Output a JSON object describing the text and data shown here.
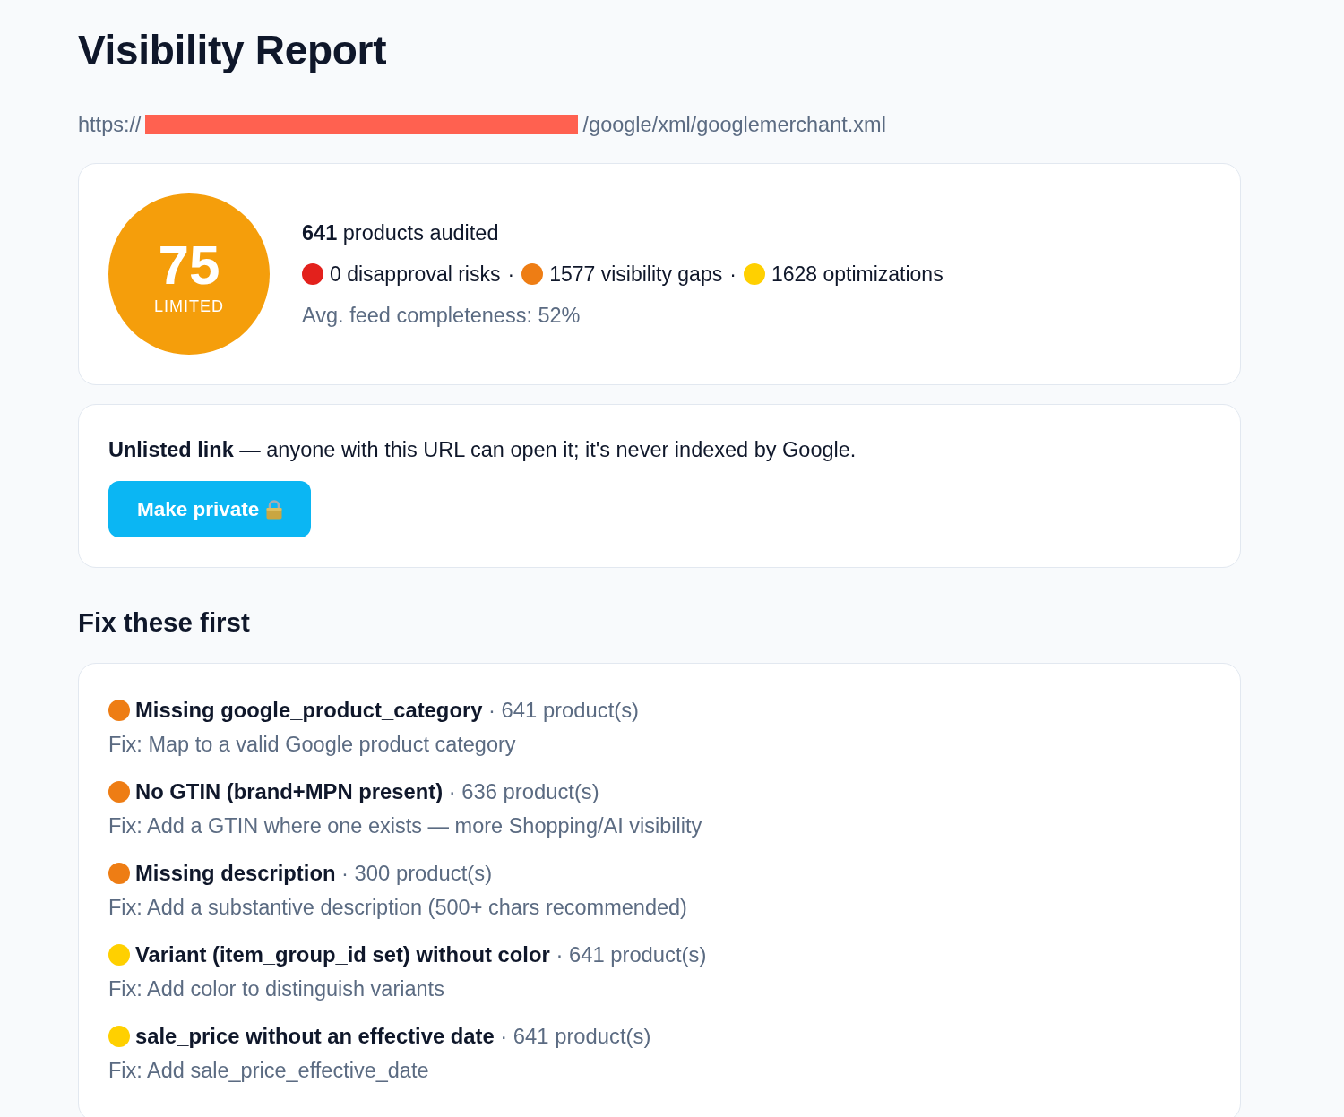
{
  "title": "Visibility Report",
  "feed_url": {
    "prefix": "https://",
    "suffix": "/google/xml/googlemerchant.xml"
  },
  "summary": {
    "score": "75",
    "rating": "LIMITED",
    "products": "**641** products audited",
    "separator": "·",
    "stats": [
      {
        "color": "#e3211c",
        "text": "0 disapproval risks"
      },
      {
        "color": "#ee7d14",
        "text": "1577 visibility gaps"
      },
      {
        "color": "#ffd000",
        "text": "1628 optimizations"
      }
    ],
    "completeness": "Avg. feed completeness: 52%"
  },
  "sharing": {
    "notice": "**Unlisted link** — anyone with this URL can open it; it's never indexed by Google.",
    "button": "Make private"
  },
  "fixes": {
    "heading": "Fix these first",
    "items": [
      {
        "color": "#ee7d14",
        "issue": "**Missing google_product_category** · 641 product(s)",
        "fix": "Fix: Map to a valid Google product category"
      },
      {
        "color": "#ee7d14",
        "issue": "**No GTIN (brand+MPN present)** · 636 product(s)",
        "fix": "Fix: Add a GTIN where one exists — more Shopping/AI visibility"
      },
      {
        "color": "#ee7d14",
        "issue": "**Missing description** · 300 product(s)",
        "fix": "Fix: Add a substantive description (500+ chars recommended)"
      },
      {
        "color": "#ffd000",
        "issue": "**Variant (item_group_id set) without color** · 641 product(s)",
        "fix": "Fix: Add color to distinguish variants"
      },
      {
        "color": "#ffd000",
        "issue": "**sale_price without an effective date** · 641 product(s)",
        "fix": "Fix: Add sale_price_effective_date"
      }
    ]
  }
}
